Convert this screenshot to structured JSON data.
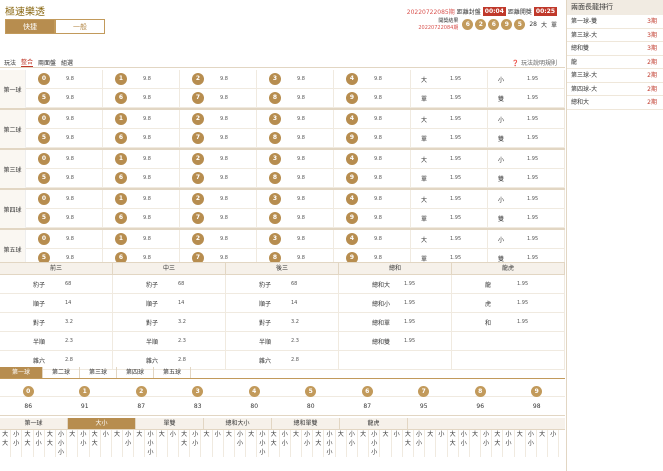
{
  "header": {
    "title": "極速樂透",
    "tabs": [
      "快捷",
      "一般"
    ],
    "current_issue": "20220722085期",
    "close_label": "距離封盤",
    "close_timer": "00:04",
    "open_label": "距離開獎",
    "open_timer": "00:25",
    "last_label": "開獎結果",
    "last_issue": "20220722084期",
    "last_balls": [
      "6",
      "2",
      "6",
      "9",
      "5"
    ],
    "sum": "28",
    "sum_big_small": "大",
    "sum_odd_even": "單"
  },
  "playbar": {
    "label": "玩法",
    "items": [
      "整合",
      "兩面盤",
      "組選"
    ],
    "rule": "玩法說明規則"
  },
  "groups": [
    {
      "name": "第一球",
      "rows": [
        {
          "balls": [
            "0",
            "1",
            "2",
            "3",
            "4"
          ],
          "odds": "9.8",
          "tlabel": "大",
          "todds": "1.95",
          "t2label": "小",
          "t2odds": "1.95"
        },
        {
          "balls": [
            "5",
            "6",
            "7",
            "8",
            "9"
          ],
          "odds": "9.8",
          "tlabel": "單",
          "todds": "1.95",
          "t2label": "雙",
          "t2odds": "1.95"
        }
      ]
    },
    {
      "name": "第二球",
      "rows": [
        {
          "balls": [
            "0",
            "1",
            "2",
            "3",
            "4"
          ],
          "odds": "9.8",
          "tlabel": "大",
          "todds": "1.95",
          "t2label": "小",
          "t2odds": "1.95"
        },
        {
          "balls": [
            "5",
            "6",
            "7",
            "8",
            "9"
          ],
          "odds": "9.8",
          "tlabel": "單",
          "todds": "1.95",
          "t2label": "雙",
          "t2odds": "1.95"
        }
      ]
    },
    {
      "name": "第三球",
      "rows": [
        {
          "balls": [
            "0",
            "1",
            "2",
            "3",
            "4"
          ],
          "odds": "9.8",
          "tlabel": "大",
          "todds": "1.95",
          "t2label": "小",
          "t2odds": "1.95"
        },
        {
          "balls": [
            "5",
            "6",
            "7",
            "8",
            "9"
          ],
          "odds": "9.8",
          "tlabel": "單",
          "todds": "1.95",
          "t2label": "雙",
          "t2odds": "1.95"
        }
      ]
    },
    {
      "name": "第四球",
      "rows": [
        {
          "balls": [
            "0",
            "1",
            "2",
            "3",
            "4"
          ],
          "odds": "9.8",
          "tlabel": "大",
          "todds": "1.95",
          "t2label": "小",
          "t2odds": "1.95"
        },
        {
          "balls": [
            "5",
            "6",
            "7",
            "8",
            "9"
          ],
          "odds": "9.8",
          "tlabel": "單",
          "todds": "1.95",
          "t2label": "雙",
          "t2odds": "1.95"
        }
      ]
    },
    {
      "name": "第五球",
      "rows": [
        {
          "balls": [
            "0",
            "1",
            "2",
            "3",
            "4"
          ],
          "odds": "9.8",
          "tlabel": "大",
          "todds": "1.95",
          "t2label": "小",
          "t2odds": "1.95"
        },
        {
          "balls": [
            "5",
            "6",
            "7",
            "8",
            "9"
          ],
          "odds": "9.8",
          "tlabel": "單",
          "todds": "1.95",
          "t2label": "雙",
          "t2odds": "1.95"
        }
      ]
    }
  ],
  "combo": {
    "headers": [
      "前三",
      "中三",
      "後三",
      "總和",
      "龍虎"
    ],
    "rows": [
      [
        [
          "豹子",
          "68"
        ],
        [
          "豹子",
          "68"
        ],
        [
          "豹子",
          "68"
        ],
        [
          "總和大",
          "1.95"
        ],
        [
          "龍",
          "1.95"
        ]
      ],
      [
        [
          "順子",
          "14"
        ],
        [
          "順子",
          "14"
        ],
        [
          "順子",
          "14"
        ],
        [
          "總和小",
          "1.95"
        ],
        [
          "虎",
          "1.95"
        ]
      ],
      [
        [
          "對子",
          "3.2"
        ],
        [
          "對子",
          "3.2"
        ],
        [
          "對子",
          "3.2"
        ],
        [
          "總和單",
          "1.95"
        ],
        [
          "和",
          "1.95"
        ]
      ],
      [
        [
          "半順",
          "2.3"
        ],
        [
          "半順",
          "2.3"
        ],
        [
          "半順",
          "2.3"
        ],
        [
          "總和雙",
          "1.95"
        ],
        [
          "",
          ""
        ]
      ],
      [
        [
          "雜六",
          "2.8"
        ],
        [
          "雜六",
          "2.8"
        ],
        [
          "雜六",
          "2.8"
        ],
        [
          "",
          ""
        ],
        [
          "",
          ""
        ]
      ]
    ]
  },
  "bz": {
    "tabs": [
      "第一球",
      "第二球",
      "第三球",
      "第四球",
      "第五球"
    ],
    "balls": [
      "0",
      "1",
      "2",
      "3",
      "4",
      "5",
      "6",
      "7",
      "8",
      "9"
    ],
    "counts": [
      "86",
      "91",
      "87",
      "83",
      "80",
      "80",
      "87",
      "95",
      "96",
      "98"
    ]
  },
  "road": {
    "tabs": [
      "第一球",
      "大小",
      "單雙",
      "總和大小",
      "總和單雙",
      "龍虎"
    ],
    "cols": [
      [
        "大",
        "大"
      ],
      [
        "小",
        "小"
      ],
      [
        "大",
        "大"
      ],
      [
        "小",
        "小"
      ],
      [
        "大",
        "大"
      ],
      [
        "小",
        "小",
        "小"
      ],
      [
        "大"
      ],
      [
        "小",
        "小"
      ],
      [
        "大",
        "大"
      ],
      [
        "小"
      ],
      [
        "大"
      ],
      [
        "小",
        "小"
      ],
      [
        "大"
      ],
      [
        "小",
        "小",
        "小"
      ],
      [
        "大"
      ],
      [
        "小"
      ],
      [
        "大",
        "大"
      ],
      [
        "小",
        "小"
      ],
      [
        "大"
      ],
      [
        "小"
      ],
      [
        "大"
      ],
      [
        "小",
        "小"
      ],
      [
        "大"
      ],
      [
        "小",
        "小",
        "小"
      ],
      [
        "大",
        "大"
      ],
      [
        "小",
        "小"
      ],
      [
        "大"
      ],
      [
        "小",
        "小"
      ],
      [
        "大",
        "大"
      ],
      [
        "小",
        "小",
        "小"
      ],
      [
        "大"
      ],
      [
        "小",
        "小"
      ],
      [
        "大"
      ],
      [
        "小",
        "小",
        "小"
      ],
      [
        "大"
      ],
      [
        "小"
      ],
      [
        "大",
        "大"
      ],
      [
        "小",
        "小"
      ],
      [
        "大"
      ],
      [
        "小"
      ],
      [
        "大",
        "大"
      ],
      [
        "小",
        "小"
      ],
      [
        "大"
      ],
      [
        "小",
        "小"
      ],
      [
        "大",
        "大"
      ],
      [
        "小",
        "小"
      ],
      [
        "大"
      ],
      [
        "小",
        "小"
      ],
      [
        "大"
      ],
      [
        "小"
      ]
    ]
  },
  "side": {
    "title": "兩面長龍排行",
    "items": [
      {
        "label": "第一球-雙",
        "count": "3期"
      },
      {
        "label": "第三球-大",
        "count": "3期"
      },
      {
        "label": "總和雙",
        "count": "3期"
      },
      {
        "label": "龍",
        "count": "2期"
      },
      {
        "label": "第三球-大",
        "count": "2期"
      },
      {
        "label": "第四球-大",
        "count": "2期"
      },
      {
        "label": "總和大",
        "count": "2期"
      }
    ]
  }
}
